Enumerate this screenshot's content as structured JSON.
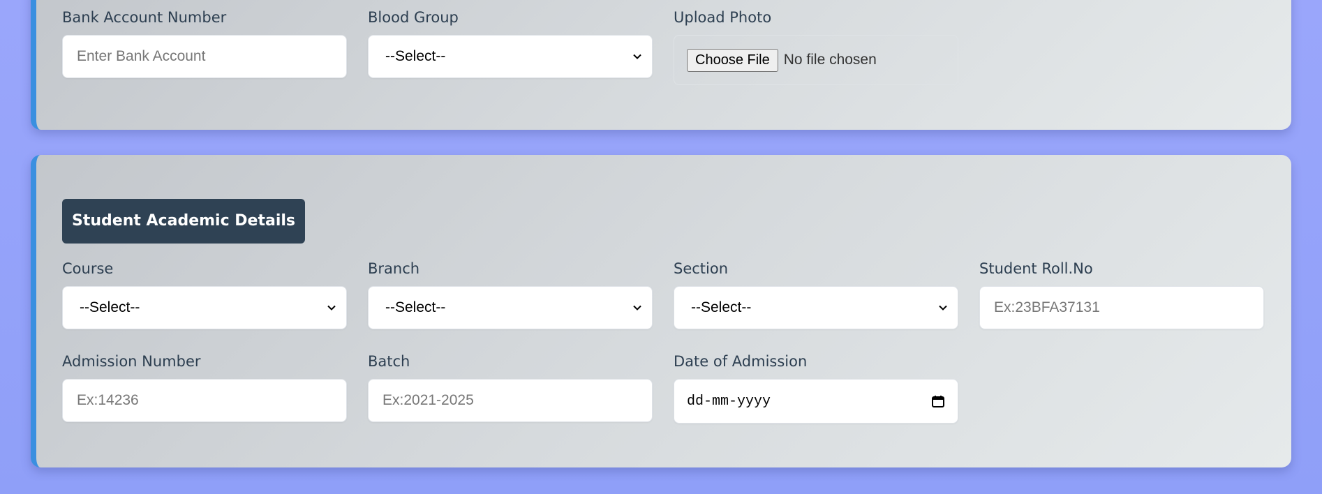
{
  "personal": {
    "bank_account": {
      "label": "Bank Account Number",
      "placeholder": "Enter Bank Account"
    },
    "blood_group": {
      "label": "Blood Group",
      "value": "--Select--"
    },
    "upload_photo": {
      "label": "Upload Photo",
      "button": "Choose File",
      "status": "No file chosen"
    }
  },
  "academic": {
    "title": "Student Academic Details",
    "course": {
      "label": "Course",
      "value": "--Select--"
    },
    "branch": {
      "label": "Branch",
      "value": "--Select--"
    },
    "section": {
      "label": "Section",
      "value": "--Select--"
    },
    "roll_no": {
      "label": "Student Roll.No",
      "placeholder": "Ex:23BFA37131"
    },
    "admission_number": {
      "label": "Admission Number",
      "placeholder": "Ex:14236"
    },
    "batch": {
      "label": "Batch",
      "placeholder": "Ex:2021-2025"
    },
    "date_of_admission": {
      "label": "Date of Admission",
      "value": "dd-mm-yyyy"
    }
  },
  "colors": {
    "accent": "#3a8fe0",
    "title_bg": "#2f4254",
    "label_text": "#2c3e50",
    "page_bg": "#9aa6fb"
  }
}
